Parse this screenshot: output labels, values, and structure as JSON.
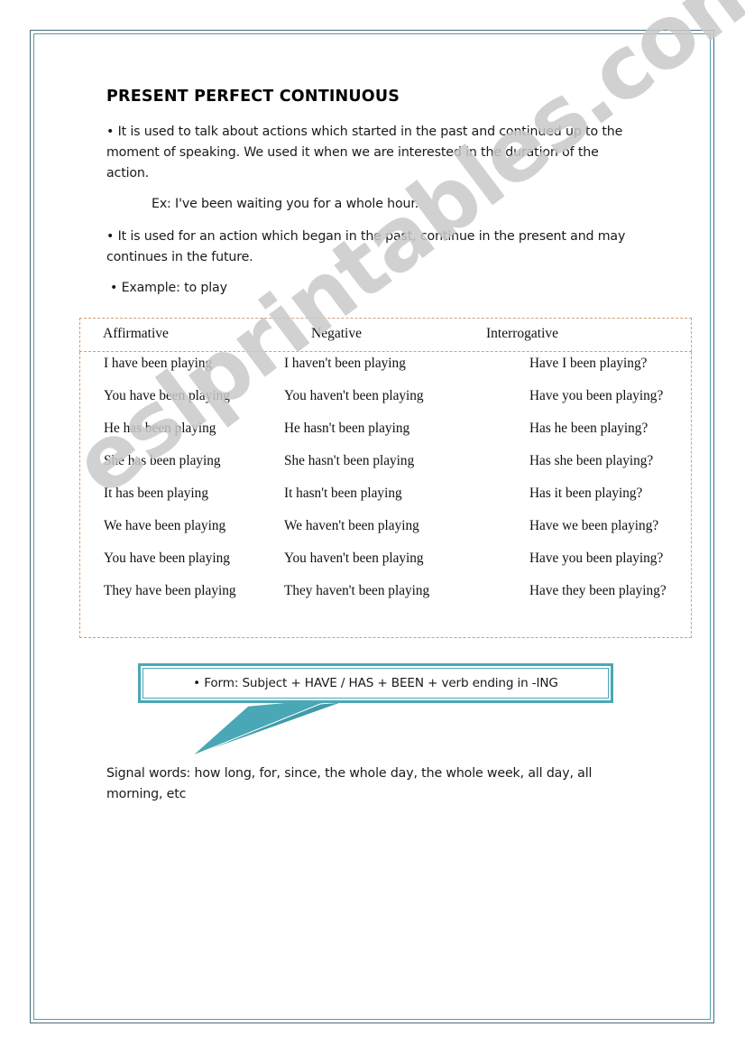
{
  "document": {
    "title": "PRESENT PERFECT CONTINUOUS",
    "watermark": "eslprintables.com",
    "paragraphs": {
      "usage_1": "• It is used to talk about actions which started in the past and continued up to the moment of speaking. We used it when we are interested in the duration of the action.",
      "example_sentence": "Ex: I've been waiting you for a whole hour.",
      "usage_2": "• It is used for an action which began in the past, continue in the present and may continues in the future.",
      "example_verb": "• Example: to play"
    },
    "table": {
      "headers": [
        "Affirmative",
        "Negative",
        "Interrogative"
      ],
      "rows": [
        [
          "I have been playing",
          "I haven't been playing",
          "Have I been playing?"
        ],
        [
          "You have been playing",
          "You haven't been playing",
          "Have you been playing?"
        ],
        [
          "He has been playing",
          "He hasn't been playing",
          "Has he been playing?"
        ],
        [
          "She has been playing",
          "She hasn't been playing",
          "Has she been playing?"
        ],
        [
          "It has been playing",
          "It hasn't been playing",
          "Has it been playing?"
        ],
        [
          "We have been playing",
          "We haven't been playing",
          "Have we been playing?"
        ],
        [
          "You have been playing",
          "You haven't been playing",
          "Have you been playing?"
        ],
        [
          "They have been playing",
          "They haven't been playing",
          "Have they been playing?"
        ]
      ]
    },
    "callout": {
      "form_rule": "• Form: Subject + HAVE / HAS + BEEN + verb ending in -ING"
    },
    "signal_words": "Signal words: how long, for, since, the whole day, the whole week, all day, all morning, etc",
    "colors": {
      "page_border_outer": "#4a6b7c",
      "page_border_inner": "#4aa0ad",
      "table_border": "#d2a077",
      "callout_border": "#4aa7b5",
      "watermark": "#c9c9c9"
    }
  }
}
